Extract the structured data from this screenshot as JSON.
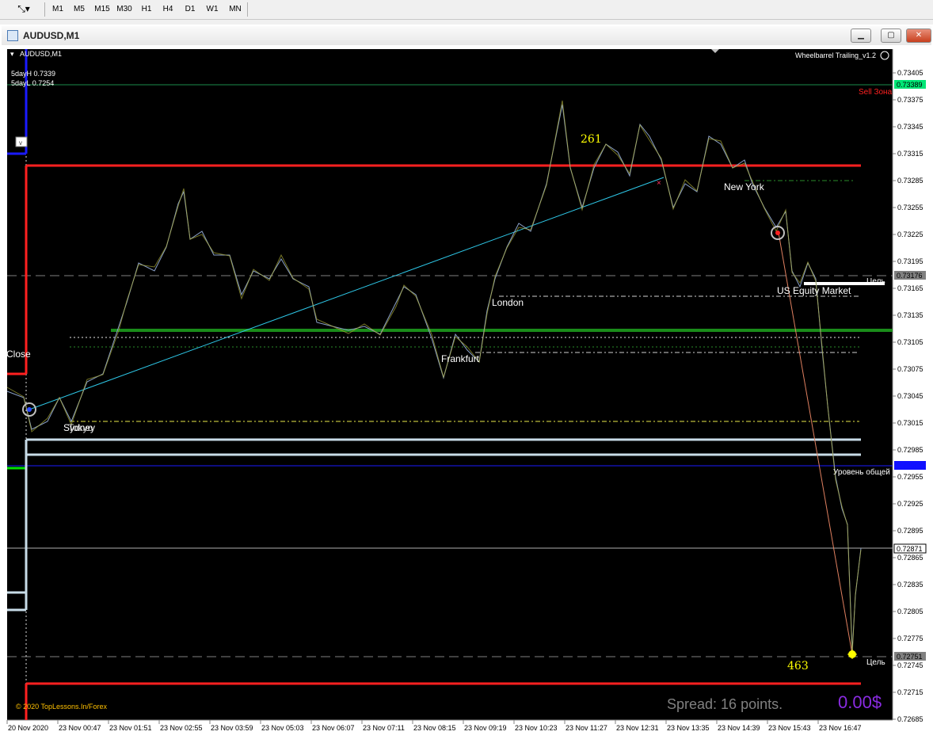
{
  "toolbar": {
    "timeframes": [
      "M1",
      "M5",
      "M15",
      "M30",
      "H1",
      "H4",
      "D1",
      "W1",
      "MN"
    ]
  },
  "window": {
    "title": "AUDUSD,M1",
    "minimize_icon": "minimize-icon",
    "maximize_icon": "maximize-icon",
    "close_icon": "close-icon"
  },
  "chart": {
    "symbol_label": "AUDUSD,M1",
    "five_day_high": "5dayH 0.7339",
    "five_day_low": "5dayL 0.7254",
    "indicator_name": "Wheelbarrel Trailing_v1.2",
    "sell_zone": "Sell Зона",
    "target_upper": "Цель",
    "target_lower": "Цель",
    "level_label": "Уровень общей",
    "close_label": "Close",
    "count_upper": "261",
    "count_lower": "463",
    "copyright": "© 2020 TopLessons.In/Forex",
    "spread": "Spread: 16 points.",
    "profit": "0.00$",
    "small_tag": "v",
    "sessions": {
      "sydney": "Sydney",
      "tokyo": "Tokyo",
      "frankfurt": "Frankfurt",
      "london": "London",
      "new_york": "New York",
      "us_equity": "US Equity Market"
    },
    "price_axis": [
      "0.73405",
      "0.73375",
      "0.73345",
      "0.73315",
      "0.73285",
      "0.73255",
      "0.73225",
      "0.73195",
      "0.73165",
      "0.73135",
      "0.73105",
      "0.73075",
      "0.73045",
      "0.73015",
      "0.72985",
      "0.72955",
      "0.72925",
      "0.72895",
      "0.72865",
      "0.72835",
      "0.72805",
      "0.72775",
      "0.72745",
      "0.72715",
      "0.72685"
    ],
    "price_tags": {
      "high_tag": "0.73389",
      "target_tag": "0.73176",
      "blue_tag": "0.72960",
      "bid_tag": "0.72871",
      "low_tag": "0.72751"
    },
    "time_axis": [
      "20 Nov 2020",
      "23 Nov 00:47",
      "23 Nov 01:51",
      "23 Nov 02:55",
      "23 Nov 03:59",
      "23 Nov 05:03",
      "23 Nov 06:07",
      "23 Nov 07:11",
      "23 Nov 08:15",
      "23 Nov 09:19",
      "23 Nov 10:23",
      "23 Nov 11:27",
      "23 Nov 12:31",
      "23 Nov 13:35",
      "23 Nov 14:39",
      "23 Nov 15:43",
      "23 Nov 16:47"
    ],
    "colors": {
      "background": "#000000",
      "price_line": "#8aa0c8",
      "resistance": "#ff2020",
      "support": "#1a8c1a",
      "trend": "#2ec8e8",
      "box": "#c8dce8",
      "count_text": "#ffff00",
      "spread_text": "#808080",
      "profit_text": "#8a2be2",
      "high_tag_bg": "#00e676",
      "blue_tag_bg": "#1010ff"
    }
  }
}
